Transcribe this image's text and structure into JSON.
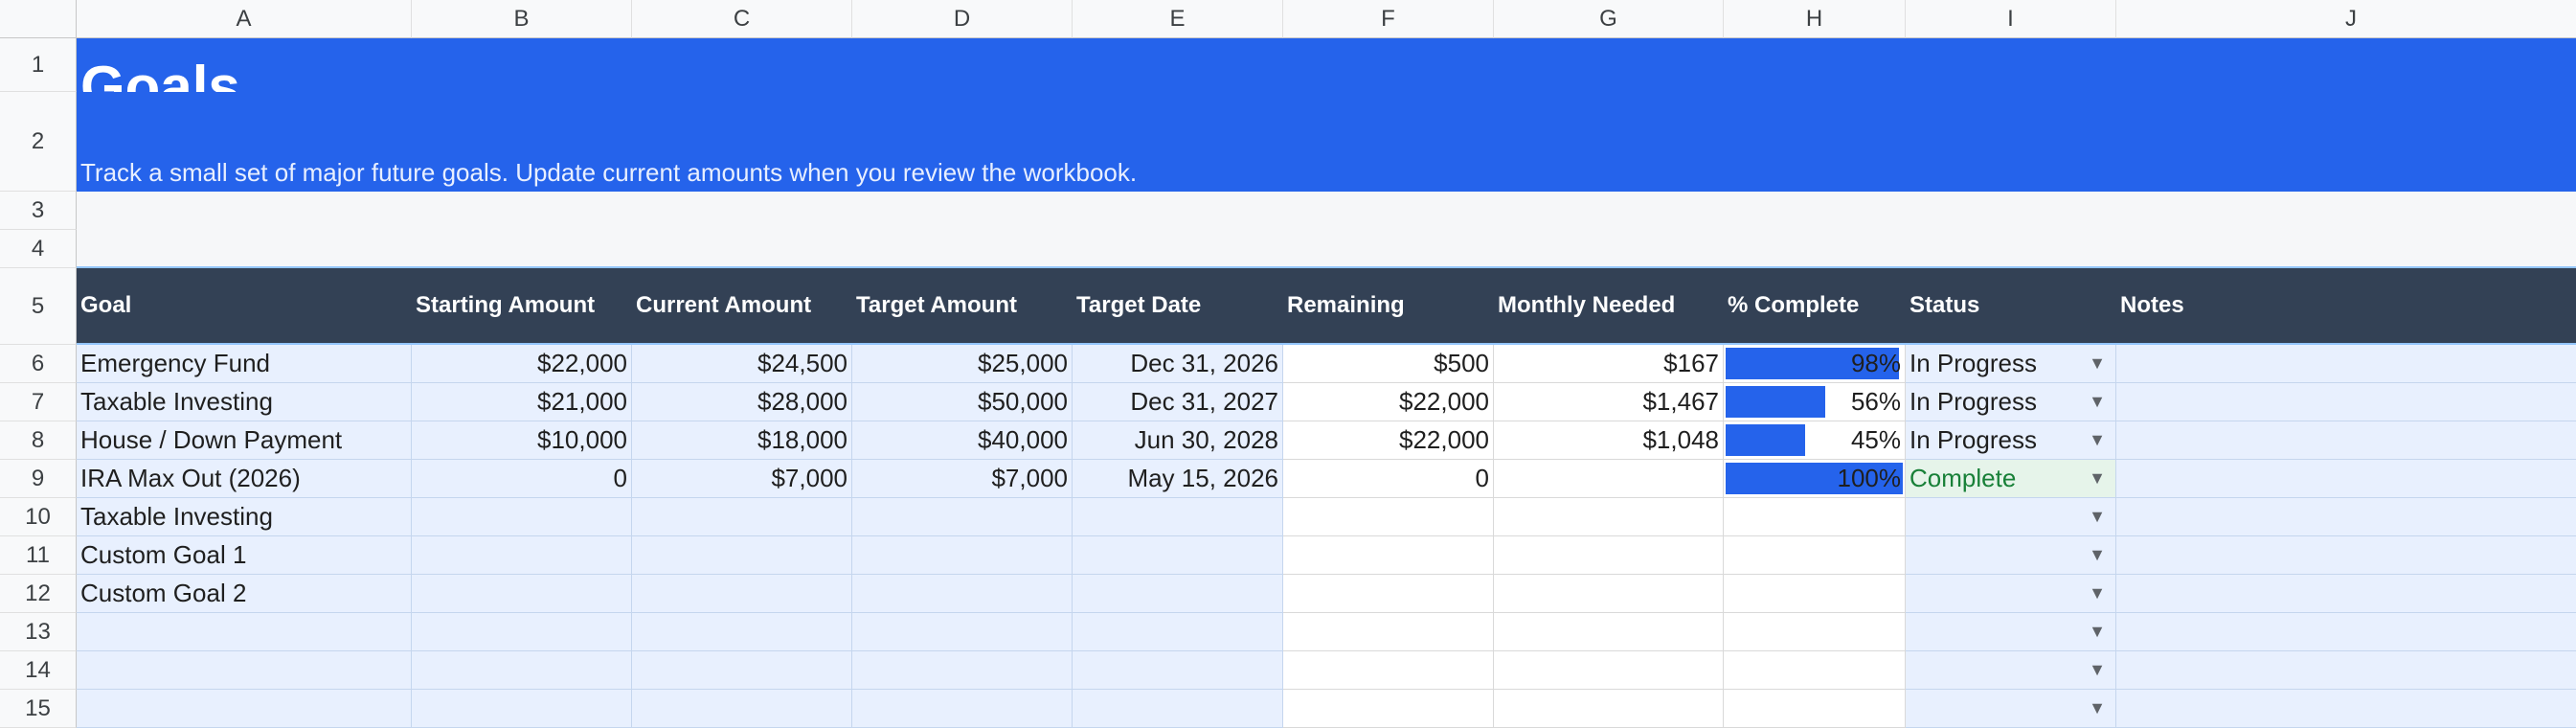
{
  "columns": [
    "A",
    "B",
    "C",
    "D",
    "E",
    "F",
    "G",
    "H",
    "I",
    "J"
  ],
  "row_numbers": [
    "1",
    "2",
    "3",
    "4",
    "5",
    "6",
    "7",
    "8",
    "9",
    "10",
    "11",
    "12",
    "13",
    "14",
    "15"
  ],
  "banner": {
    "title": "Goals",
    "subtitle": "Track a small set of major future goals. Update current amounts when you review the workbook."
  },
  "headers": [
    "Goal",
    "Starting Amount",
    "Current Amount",
    "Target Amount",
    "Target Date",
    "Remaining",
    "Monthly Needed",
    "% Complete",
    "Status",
    "Notes"
  ],
  "rows": [
    {
      "goal": "Emergency Fund",
      "starting": "$22,000",
      "current": "$24,500",
      "target": "$25,000",
      "date": "Dec 31, 2026",
      "remaining": "$500",
      "monthly": "$167",
      "pct": "98%",
      "pct_value": 0.98,
      "status": "In Progress",
      "notes": ""
    },
    {
      "goal": "Taxable Investing",
      "starting": "$21,000",
      "current": "$28,000",
      "target": "$50,000",
      "date": "Dec 31, 2027",
      "remaining": "$22,000",
      "monthly": "$1,467",
      "pct": "56%",
      "pct_value": 0.56,
      "status": "In Progress",
      "notes": ""
    },
    {
      "goal": "House / Down Payment",
      "starting": "$10,000",
      "current": "$18,000",
      "target": "$40,000",
      "date": "Jun 30, 2028",
      "remaining": "$22,000",
      "monthly": "$1,048",
      "pct": "45%",
      "pct_value": 0.45,
      "status": "In Progress",
      "notes": ""
    },
    {
      "goal": "IRA Max Out (2026)",
      "starting": "0",
      "current": "$7,000",
      "target": "$7,000",
      "date": "May 15, 2026",
      "remaining": "0",
      "monthly": "",
      "pct": "100%",
      "pct_value": 1.0,
      "status": "Complete",
      "notes": ""
    },
    {
      "goal": "Taxable Investing",
      "starting": "",
      "current": "",
      "target": "",
      "date": "",
      "remaining": "",
      "monthly": "",
      "pct": "",
      "pct_value": null,
      "status": "",
      "notes": ""
    },
    {
      "goal": "Custom Goal 1",
      "starting": "",
      "current": "",
      "target": "",
      "date": "",
      "remaining": "",
      "monthly": "",
      "pct": "",
      "pct_value": null,
      "status": "",
      "notes": ""
    },
    {
      "goal": "Custom Goal 2",
      "starting": "",
      "current": "",
      "target": "",
      "date": "",
      "remaining": "",
      "monthly": "",
      "pct": "",
      "pct_value": null,
      "status": "",
      "notes": ""
    },
    {
      "goal": "",
      "starting": "",
      "current": "",
      "target": "",
      "date": "",
      "remaining": "",
      "monthly": "",
      "pct": "",
      "pct_value": null,
      "status": "",
      "notes": ""
    },
    {
      "goal": "",
      "starting": "",
      "current": "",
      "target": "",
      "date": "",
      "remaining": "",
      "monthly": "",
      "pct": "",
      "pct_value": null,
      "status": "",
      "notes": ""
    },
    {
      "goal": "",
      "starting": "",
      "current": "",
      "target": "",
      "date": "",
      "remaining": "",
      "monthly": "",
      "pct": "",
      "pct_value": null,
      "status": "",
      "notes": ""
    }
  ],
  "icons": {
    "dropdown": "dropdown-caret-icon"
  },
  "colors": {
    "banner": "#2563eb",
    "header": "#334155",
    "input_fill": "#e8f0fe",
    "progress_bar": "#2563eb",
    "complete_text": "#188038",
    "complete_fill": "#e6f4ea"
  }
}
